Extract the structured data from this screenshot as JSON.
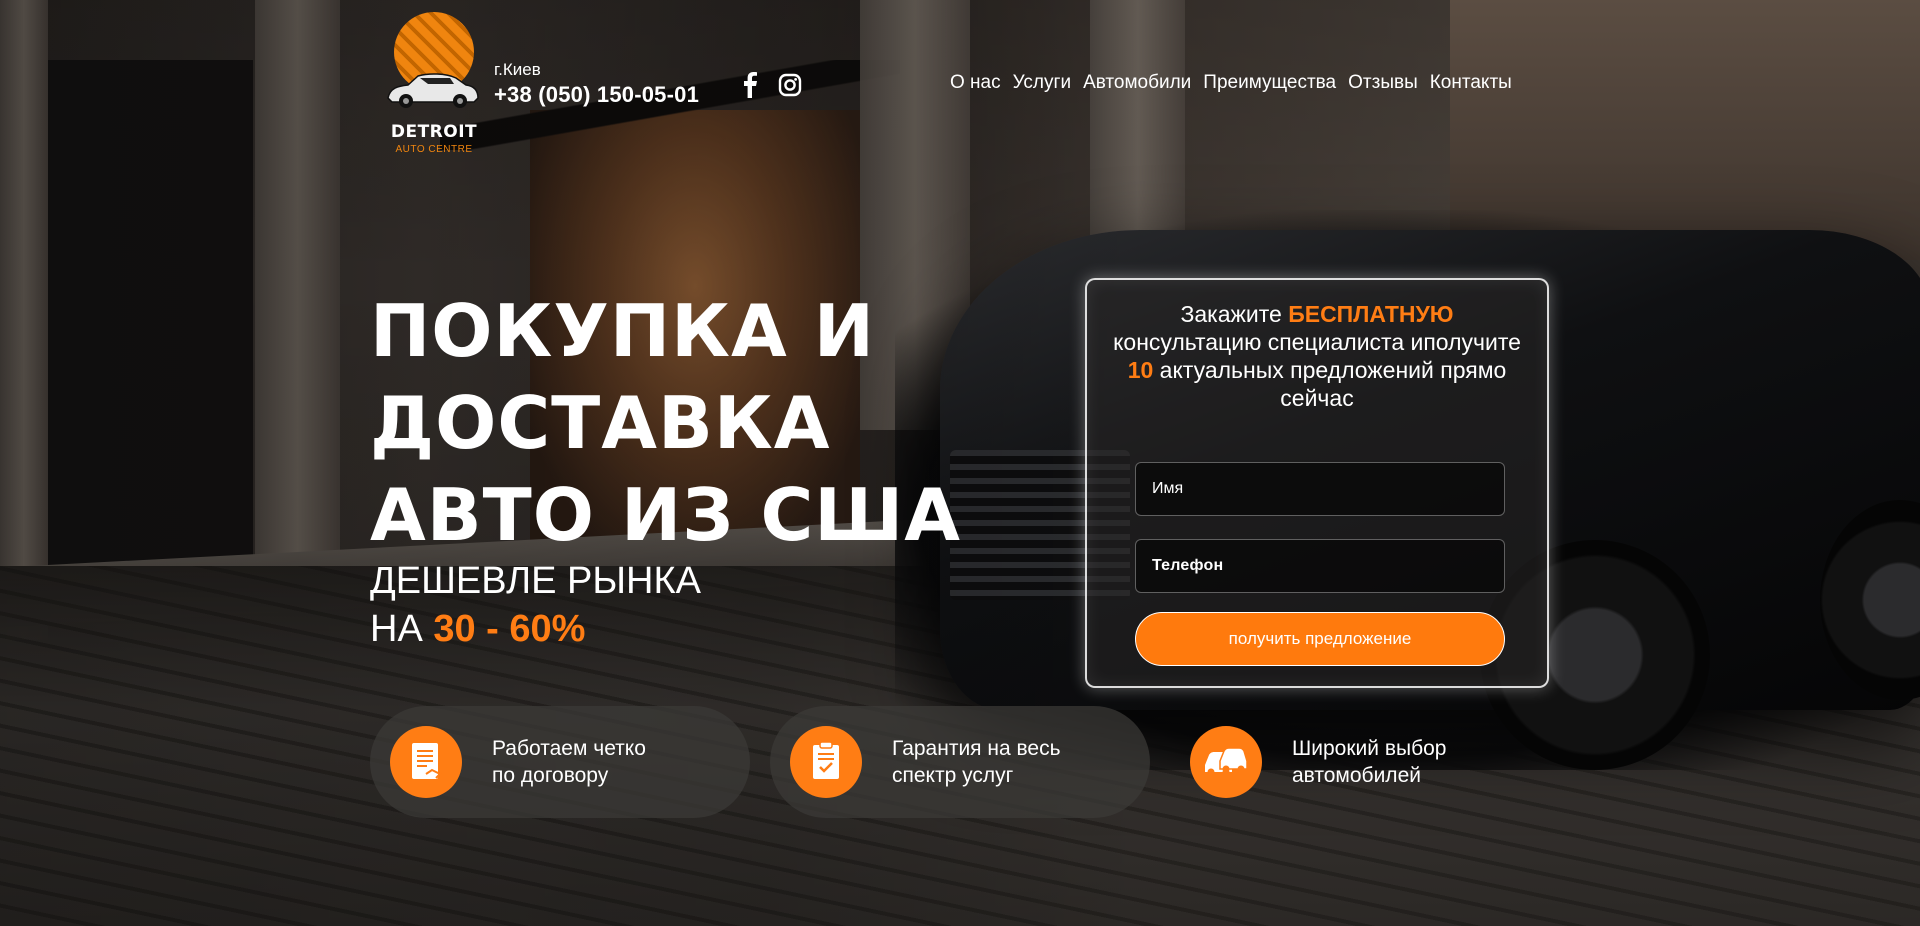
{
  "brand": {
    "logo_title": "DETROIT",
    "logo_subtitle": "AUTO CENTRE",
    "accent_color": "#ff7d14"
  },
  "contacts": {
    "city": "г.Киев",
    "phone": "+38 (050) 150-05-01",
    "socials": [
      "facebook-icon",
      "instagram-icon"
    ]
  },
  "nav": {
    "items": [
      "О нас",
      "Услуги",
      "Автомобили",
      "Преимущества",
      "Отзывы",
      "Контакты"
    ]
  },
  "hero": {
    "title_lines": [
      "ПОКУПКА И",
      "ДОСТАВКА",
      "АВТО ИЗ США"
    ],
    "subtitle_line1": "ДЕШЕВЛЕ РЫНКА",
    "subtitle_prefix": "НА",
    "subtitle_accent": "30 - 60%"
  },
  "form": {
    "head_part1": "Закажите",
    "head_highlight1": "БЕСПЛАТНУЮ",
    "head_part2": "консультацию специалиста иполучите",
    "head_highlight2": "10",
    "head_part3": "актуальных предложений прямо сейчас",
    "name_placeholder": "Имя",
    "phone_placeholder": "Телефон",
    "submit_label": "получить предложение"
  },
  "features": [
    {
      "icon": "contract-icon",
      "lines": [
        "Работаем четко",
        "по договору"
      ]
    },
    {
      "icon": "guarantee-icon",
      "lines": [
        "Гарантия на весь",
        "спектр услуг"
      ]
    },
    {
      "icon": "cars-icon",
      "lines": [
        "Широкий выбор",
        "автомобилей"
      ]
    }
  ]
}
